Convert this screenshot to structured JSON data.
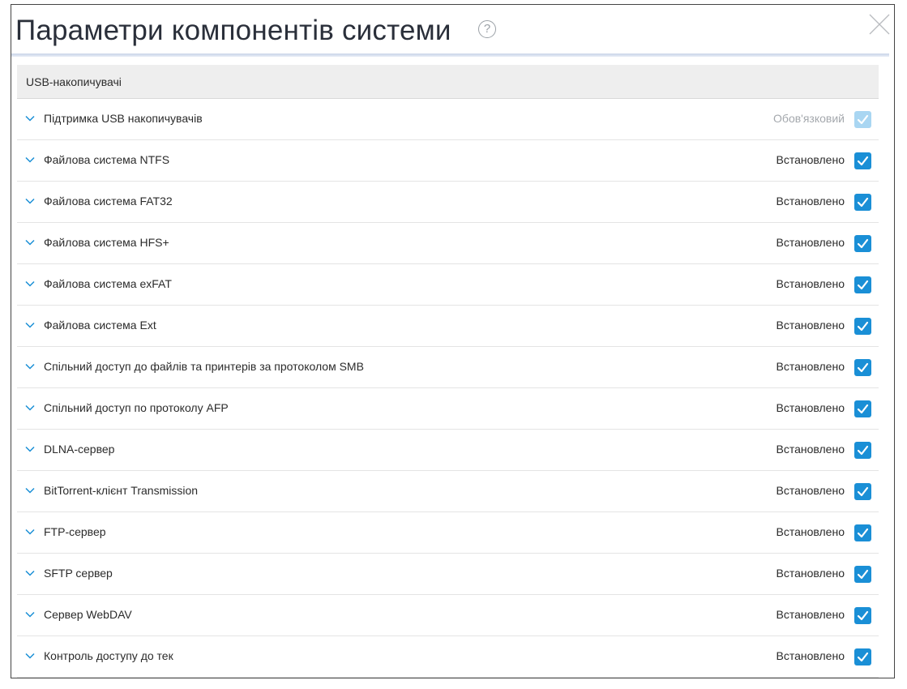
{
  "dialog": {
    "title": "Параметри компонентів системи",
    "help_glyph": "?"
  },
  "section": {
    "title": "USB-накопичувачі"
  },
  "colors": {
    "accent": "#1a8fd6",
    "accent_disabled": "#a9d6f2"
  },
  "components": [
    {
      "label": "Підтримка USB накопичувачів",
      "status": "Обов'язковий",
      "checked": true,
      "disabled": true
    },
    {
      "label": "Файлова система NTFS",
      "status": "Встановлено",
      "checked": true,
      "disabled": false
    },
    {
      "label": "Файлова система FAT32",
      "status": "Встановлено",
      "checked": true,
      "disabled": false
    },
    {
      "label": "Файлова система HFS+",
      "status": "Встановлено",
      "checked": true,
      "disabled": false
    },
    {
      "label": "Файлова система exFAT",
      "status": "Встановлено",
      "checked": true,
      "disabled": false
    },
    {
      "label": "Файлова система Ext",
      "status": "Встановлено",
      "checked": true,
      "disabled": false
    },
    {
      "label": "Спільний доступ до файлів та принтерів за протоколом SMB",
      "status": "Встановлено",
      "checked": true,
      "disabled": false
    },
    {
      "label": "Спільний доступ по протоколу AFP",
      "status": "Встановлено",
      "checked": true,
      "disabled": false
    },
    {
      "label": "DLNA-сервер",
      "status": "Встановлено",
      "checked": true,
      "disabled": false
    },
    {
      "label": "BitTorrent-клієнт Transmission",
      "status": "Встановлено",
      "checked": true,
      "disabled": false
    },
    {
      "label": "FTP-сервер",
      "status": "Встановлено",
      "checked": true,
      "disabled": false
    },
    {
      "label": "SFTP сервер",
      "status": "Встановлено",
      "checked": true,
      "disabled": false
    },
    {
      "label": "Сервер WebDAV",
      "status": "Встановлено",
      "checked": true,
      "disabled": false
    },
    {
      "label": "Контроль доступу до тек",
      "status": "Встановлено",
      "checked": true,
      "disabled": false
    }
  ]
}
